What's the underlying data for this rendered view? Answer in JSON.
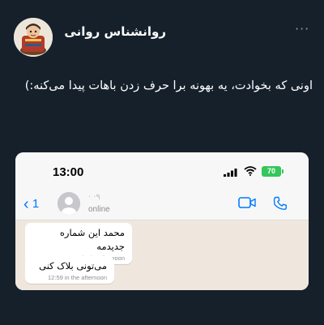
{
  "tweet": {
    "author_name": "روانشناس روانی",
    "more_label": "···",
    "text": "اونی که بخوادت، یه بهونه برا حرف زدن باهات پیدا می‌کنه:)"
  },
  "screenshot": {
    "status_bar": {
      "time": "13:00",
      "battery": "70"
    },
    "chat_header": {
      "back_label": "1",
      "contact_name": "· ·٩",
      "status": "online"
    },
    "messages": [
      {
        "text": "محمد این شماره جدیدمه",
        "time": "12:59 in the afternoon"
      },
      {
        "text": "می‌تونی بلاک کنی",
        "time": "12:59 in the afternoon"
      }
    ],
    "icons": {
      "back": "chevron-left-icon",
      "video": "video-camera-icon",
      "call": "phone-icon",
      "signal": "signal-icon",
      "wifi": "wifi-icon"
    },
    "colors": {
      "accent": "#007aff",
      "battery": "#34c759",
      "chat_background": "#efe7dd"
    }
  },
  "colors": {
    "background": "#15202b",
    "text": "#ffffff",
    "muted": "#8b98a5"
  }
}
